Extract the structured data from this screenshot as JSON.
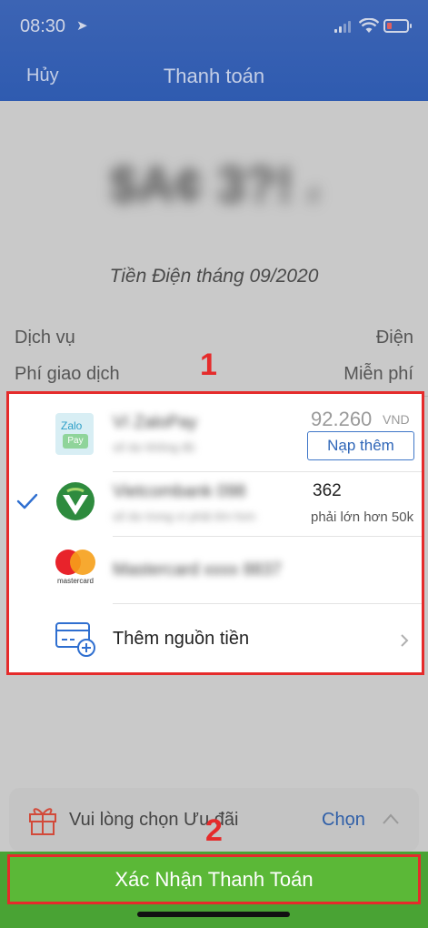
{
  "status_bar": {
    "time": "08:30",
    "location_glyph": "➤"
  },
  "nav": {
    "cancel_label": "Hủy",
    "title": "Thanh toán"
  },
  "payment": {
    "amount_blurred": "$A¢ 3?!",
    "amount_suffix": "đ",
    "bill_description": "Tiền Điện tháng 09/2020",
    "rows": [
      {
        "label": "Dịch vụ",
        "value": "Điện"
      },
      {
        "label": "Phí giao dịch",
        "value": "Miễn phí"
      }
    ]
  },
  "sources": {
    "zalopay": {
      "logo_top": "Zalo",
      "logo_bottom": "Pay",
      "name_blurred": "Ví ZaloPay",
      "sub_blurred": "số dư không đủ",
      "balance": "92.260",
      "currency": "VND",
      "topup_label": "Nạp thêm"
    },
    "vietcombank": {
      "name_blurred": "Vietcombank 098",
      "masked": "362",
      "sub_blurred": "số dư trong ví phải lớn hơn",
      "sub_visible": "phải lớn hơn 50k",
      "selected": true
    },
    "mastercard": {
      "brand": "mastercard",
      "name_blurred": "Mastercard xxxx 8837"
    },
    "add_source": {
      "label": "Thêm nguồn tiền"
    }
  },
  "annotations": {
    "box1": "1",
    "box2": "2"
  },
  "promo": {
    "label": "Vui lòng chọn Ưu đãi",
    "action": "Chọn"
  },
  "confirm": {
    "label": "Xác Nhận Thanh Toán"
  },
  "colors": {
    "accent_blue": "#2f5bb0",
    "confirm_green": "#5bb837",
    "highlight_red": "#e52b2b"
  },
  "icons": [
    "location-arrow-icon",
    "signal-icon",
    "wifi-icon",
    "battery-icon",
    "zalopay-logo",
    "vietcombank-logo",
    "mastercard-logo",
    "add-card-icon",
    "checkmark-icon",
    "chevron-right-icon",
    "gift-icon",
    "chevron-up-icon"
  ]
}
